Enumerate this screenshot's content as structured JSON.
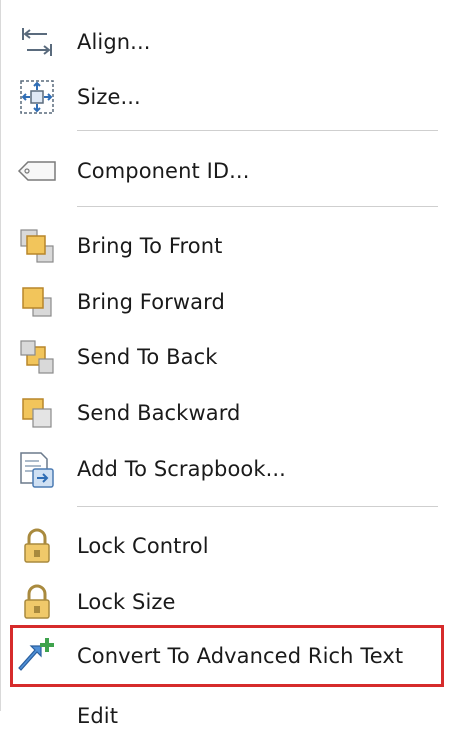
{
  "menu": {
    "items": [
      {
        "label": "Align...",
        "icon": "align-icon"
      },
      {
        "label": "Size...",
        "icon": "size-icon"
      },
      {
        "label": "Component ID...",
        "icon": "tag-icon"
      },
      {
        "label": "Bring To Front",
        "icon": "bring-to-front-icon"
      },
      {
        "label": "Bring Forward",
        "icon": "bring-forward-icon"
      },
      {
        "label": "Send To Back",
        "icon": "send-to-back-icon"
      },
      {
        "label": "Send Backward",
        "icon": "send-backward-icon"
      },
      {
        "label": "Add To Scrapbook...",
        "icon": "scrapbook-icon"
      },
      {
        "label": "Lock Control",
        "icon": "padlock-icon"
      },
      {
        "label": "Lock Size",
        "icon": "padlock-icon"
      },
      {
        "label": "Convert To Advanced Rich Text",
        "icon": "convert-arrow-plus-icon"
      },
      {
        "label": "Edit",
        "icon": ""
      }
    ],
    "highlighted_item": "Convert To Advanced Rich Text",
    "highlight_color": "#d62b2b"
  }
}
